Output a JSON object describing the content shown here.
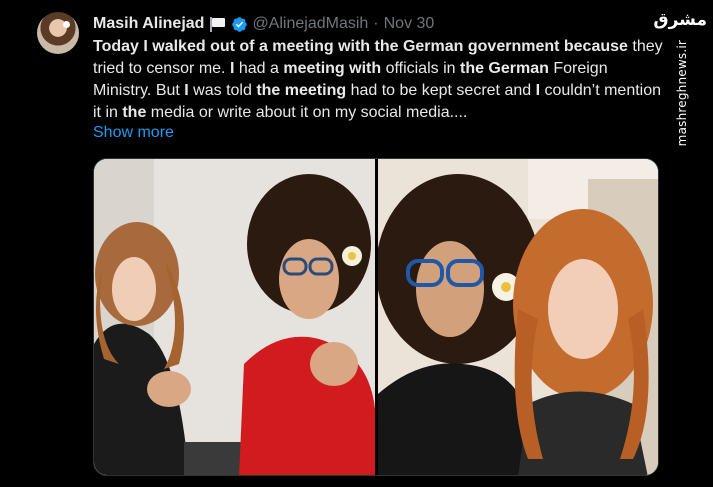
{
  "tweet": {
    "author_name": "Masih Alinejad",
    "handle": "@AlinejadMasih",
    "separator": "·",
    "date": "Nov 30",
    "text_segments": [
      {
        "text": "Today I walked out of a meeting with the German government because",
        "bold": true
      },
      {
        "text": " they tried to censor me. ",
        "bold": false
      },
      {
        "text": "I",
        "bold": true
      },
      {
        "text": " had a ",
        "bold": false
      },
      {
        "text": "meeting with",
        "bold": true
      },
      {
        "text": " officials in ",
        "bold": false
      },
      {
        "text": "the German",
        "bold": true
      },
      {
        "text": " Foreign Ministry. But ",
        "bold": false
      },
      {
        "text": "I",
        "bold": true
      },
      {
        "text": " was told ",
        "bold": false
      },
      {
        "text": "the meeting",
        "bold": true
      },
      {
        "text": " had to be kept secret and ",
        "bold": false
      },
      {
        "text": "I",
        "bold": true
      },
      {
        "text": " couldn’t mention it in ",
        "bold": false
      },
      {
        "text": "the",
        "bold": true
      },
      {
        "text": " media or write about it on my social media....",
        "bold": false
      }
    ],
    "show_more_label": "Show more"
  },
  "watermark": {
    "logo_text": "مشرق",
    "url": "mashreghnews.ir"
  },
  "icons": {
    "avatar": "avatar-photo",
    "flag": "white-flag-icon",
    "verified": "verified-badge-icon"
  },
  "colors": {
    "background": "#000000",
    "text": "#e7e9ea",
    "muted": "#71767b",
    "link": "#1d9bf0",
    "verified": "#1d9bf0"
  }
}
